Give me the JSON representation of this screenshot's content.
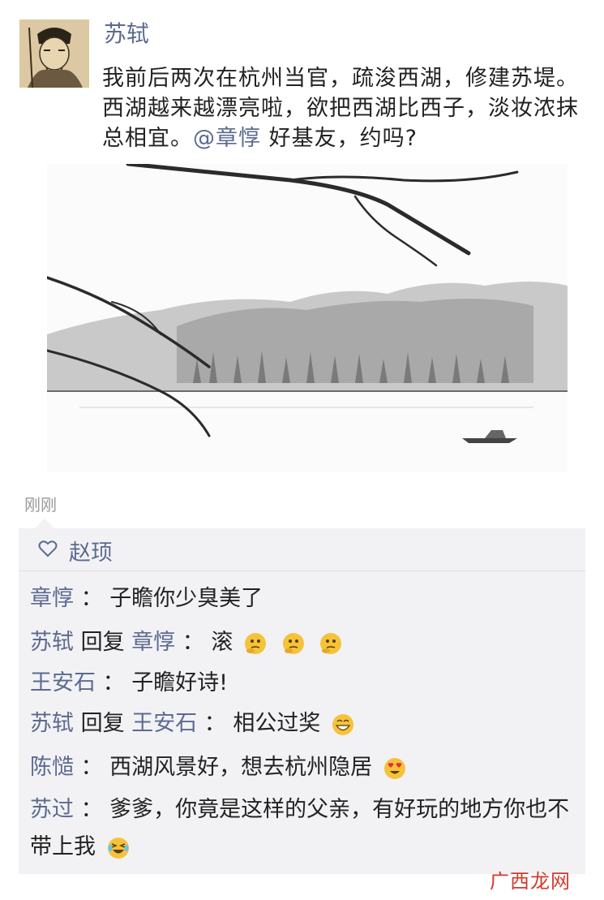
{
  "post": {
    "author": "苏轼",
    "text_before": "我前后两次在杭州当官，疏浚西湖，修建苏堤。西湖越来越漂亮啦，欲把西湖比西子，淡妆浓抹总相宜。",
    "mention": "@章惇",
    "text_after": " 好基友，约吗?",
    "timestamp": "刚刚"
  },
  "likes": {
    "names": "赵顼"
  },
  "comments": [
    {
      "name": "章惇",
      "separator": "：",
      "text": "子瞻你少臭美了",
      "emojis": []
    },
    {
      "name": "苏轼",
      "reply_word": "回复",
      "reply_to": "章惇",
      "separator": "：",
      "text": "滚",
      "emojis": [
        "thinking-emoji",
        "thinking-emoji",
        "thinking-emoji"
      ]
    },
    {
      "name": "王安石",
      "separator": "：",
      "text": "子瞻好诗!",
      "emojis": []
    },
    {
      "name": "苏轼",
      "reply_word": "回复",
      "reply_to": "王安石",
      "separator": "：",
      "text": "相公过奖",
      "emojis": [
        "grin-emoji"
      ]
    },
    {
      "name": "陈慥",
      "separator": "：",
      "text": "西湖风景好，想去杭州隐居",
      "emojis": [
        "heart-eyes-emoji"
      ]
    },
    {
      "name": "苏过",
      "separator": "：",
      "text": "爹爹，你竟是这样的父亲，有好玩的地方你也不带上我",
      "emojis": [
        "laughing-tears-emoji"
      ]
    }
  ],
  "watermark": "广西龙网",
  "colors": {
    "name_blue": "#5c6a8f",
    "panel_bg": "#f2f2f5",
    "watermark_red": "#d33a2c"
  }
}
